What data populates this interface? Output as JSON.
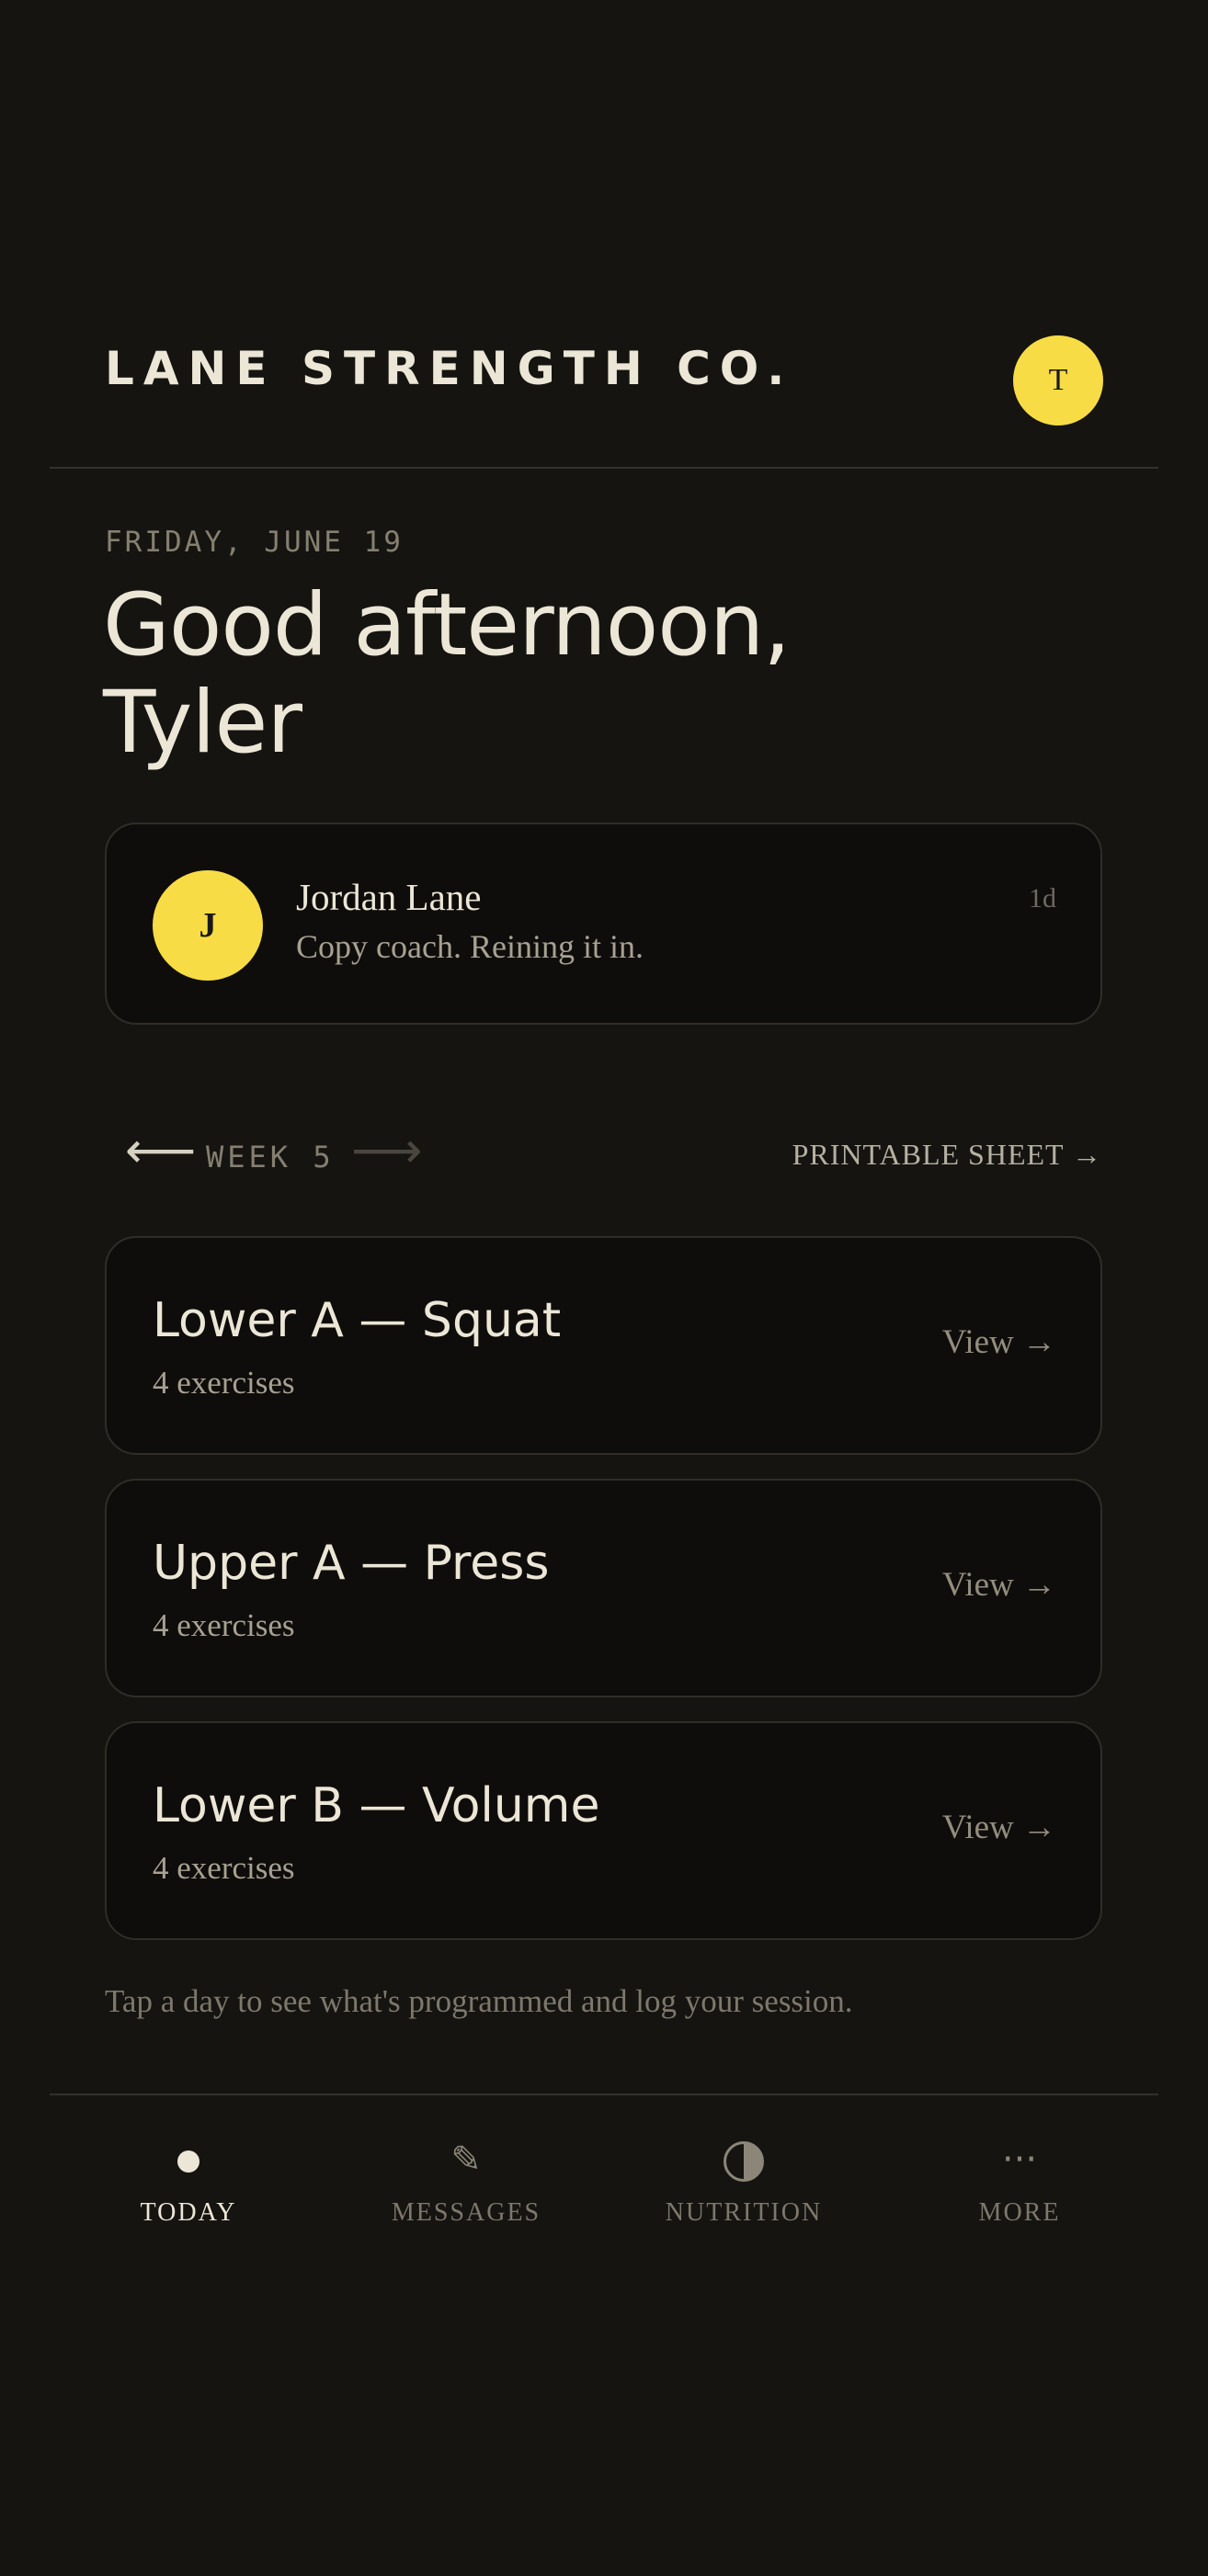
{
  "header": {
    "brand": "LANE STRENGTH CO.",
    "avatar_initial": "T"
  },
  "greeting": {
    "date": "FRIDAY, JUNE 19",
    "line1": "Good afternoon,",
    "line2": "Tyler"
  },
  "message": {
    "avatar_initial": "J",
    "sender": "Jordan Lane",
    "preview": "Copy coach. Reining it in.",
    "time": "1d"
  },
  "week_nav": {
    "prev_icon": "arrow-left-icon",
    "label": "WEEK 5",
    "next_icon": "arrow-right-icon",
    "printable": "PRINTABLE SHEET →"
  },
  "days": [
    {
      "title": "Lower A — Squat",
      "subtitle": "4 exercises",
      "action": "View →"
    },
    {
      "title": "Upper A — Press",
      "subtitle": "4 exercises",
      "action": "View →"
    },
    {
      "title": "Lower B — Volume",
      "subtitle": "4 exercises",
      "action": "View →"
    }
  ],
  "hint": "Tap a day to see what's programmed and log your session.",
  "bottom_nav": {
    "items": [
      {
        "label": "TODAY",
        "icon": "dot-icon",
        "active": true
      },
      {
        "label": "MESSAGES",
        "icon": "pencil-icon",
        "active": false
      },
      {
        "label": "NUTRITION",
        "icon": "half-circle-icon",
        "active": false
      },
      {
        "label": "MORE",
        "icon": "ellipsis-icon",
        "active": false
      }
    ]
  },
  "colors": {
    "background": "#151411",
    "accent": "#f7dc45",
    "text": "#ece6d6",
    "muted": "#85806f"
  }
}
